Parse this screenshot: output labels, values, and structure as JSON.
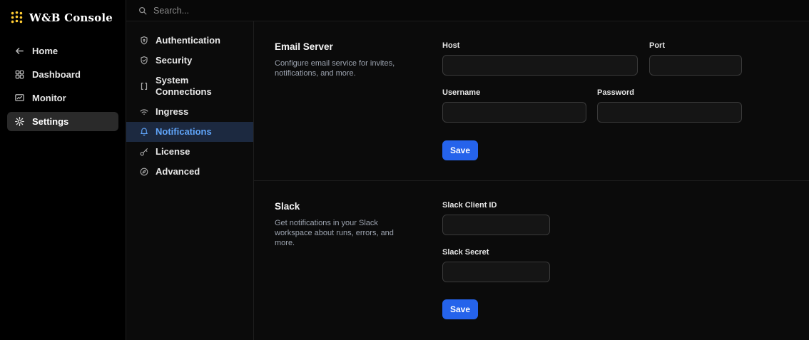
{
  "brand": {
    "title": "W&B Console"
  },
  "topbar": {
    "search_placeholder": "Search..."
  },
  "sidebar": {
    "items": [
      {
        "label": "Home",
        "icon": "arrow-left-icon",
        "selected": false
      },
      {
        "label": "Dashboard",
        "icon": "dashboard-grid-icon",
        "selected": false
      },
      {
        "label": "Monitor",
        "icon": "monitor-icon",
        "selected": false
      },
      {
        "label": "Settings",
        "icon": "gear-icon",
        "selected": true
      }
    ]
  },
  "subnav": {
    "items": [
      {
        "label": "Authentication",
        "icon": "shield-icon",
        "selected": false
      },
      {
        "label": "Security",
        "icon": "shield-check-icon",
        "selected": false
      },
      {
        "label": "System Connections",
        "icon": "brackets-icon",
        "selected": false
      },
      {
        "label": "Ingress",
        "icon": "wifi-icon",
        "selected": false
      },
      {
        "label": "Notifications",
        "icon": "bell-icon",
        "selected": true
      },
      {
        "label": "License",
        "icon": "key-icon",
        "selected": false
      },
      {
        "label": "Advanced",
        "icon": "compass-icon",
        "selected": false
      }
    ]
  },
  "email_section": {
    "title": "Email Server",
    "description": "Configure email service for invites, notifications, and more.",
    "host_label": "Host",
    "host_value": "",
    "port_label": "Port",
    "port_value": "",
    "username_label": "Username",
    "username_value": "",
    "password_label": "Password",
    "password_value": "",
    "save_label": "Save"
  },
  "slack_section": {
    "title": "Slack",
    "description": "Get notifications in your Slack workspace about runs, errors, and more.",
    "client_id_label": "Slack Client ID",
    "client_id_value": "",
    "secret_label": "Slack Secret",
    "secret_value": "",
    "save_label": "Save"
  },
  "colors": {
    "accent": "#2563eb",
    "logo_yellow": "#ffcc33",
    "selected_blue": "#60a5fa"
  }
}
